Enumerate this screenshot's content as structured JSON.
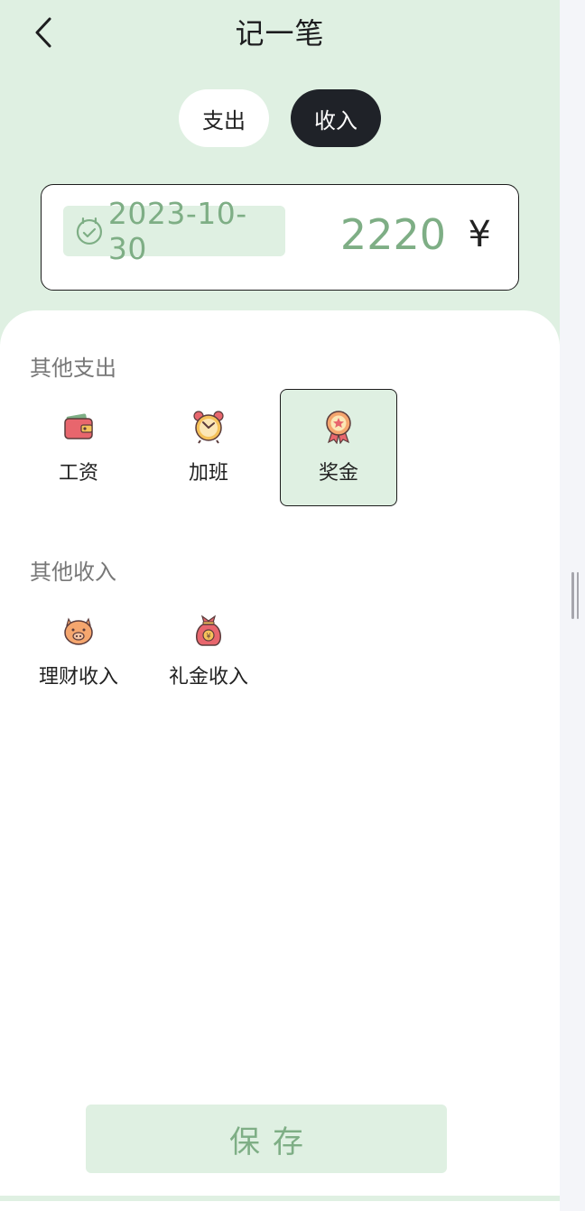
{
  "header": {
    "title": "记一笔",
    "back_icon": "chevron-left-icon"
  },
  "type_toggle": {
    "expense_label": "支出",
    "income_label": "收入",
    "selected": "收入"
  },
  "entry": {
    "date": "2023-10-30",
    "amount": "2220",
    "currency": "¥",
    "date_icon": "calendar-check-icon"
  },
  "sections": [
    {
      "title": "其他支出",
      "items": [
        {
          "label": "工资",
          "icon": "wallet-icon",
          "selected": false
        },
        {
          "label": "加班",
          "icon": "alarm-clock-icon",
          "selected": false
        },
        {
          "label": "奖金",
          "icon": "medal-icon",
          "selected": true
        }
      ]
    },
    {
      "title": "其他收入",
      "items": [
        {
          "label": "理财收入",
          "icon": "piggy-bank-icon",
          "selected": false
        },
        {
          "label": "礼金收入",
          "icon": "money-bag-icon",
          "selected": false
        }
      ]
    }
  ],
  "save_label": "保存",
  "colors": {
    "accent": "#7eae85",
    "accent_bg": "#dff0e2",
    "dark": "#1f2228"
  }
}
